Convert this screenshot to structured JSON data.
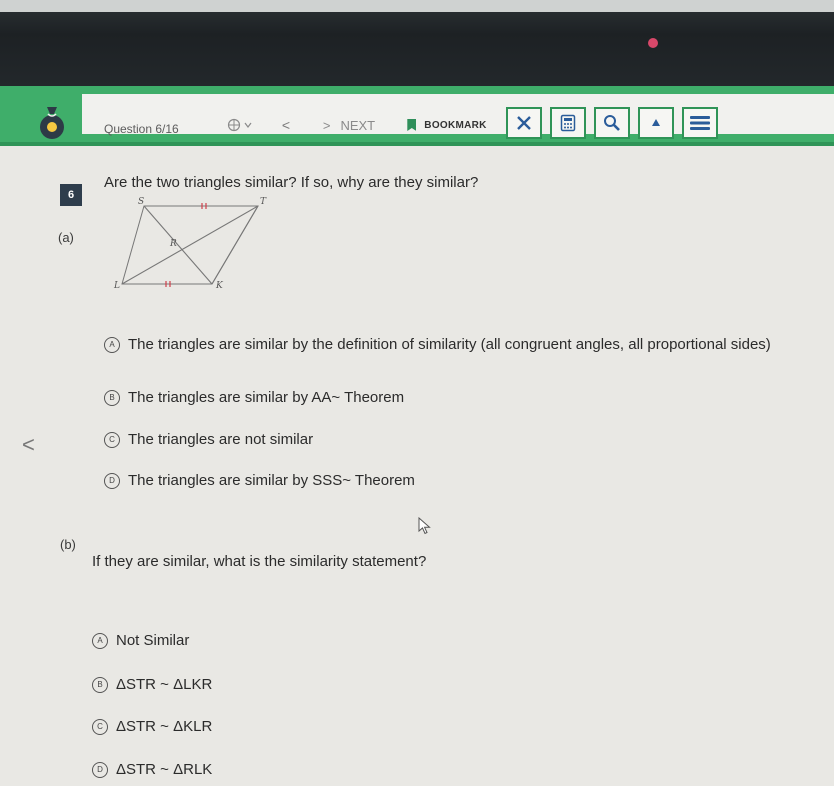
{
  "header": {
    "question_label": "Question 6/16",
    "next_label": "NEXT",
    "bookmark_label": "BOOKMARK",
    "prev_glyph": "<",
    "next_glyph": ">"
  },
  "question": {
    "number": "6",
    "prompt": "Are the two triangles similar? If so, why are they similar?",
    "part_a": {
      "label": "(a)",
      "figure_labels": {
        "S": "S",
        "T": "T",
        "R": "R",
        "L": "L",
        "K": "K"
      },
      "options": [
        {
          "letter": "A",
          "text": "The triangles are similar by the definition of similarity (all congruent angles, all proportional sides)"
        },
        {
          "letter": "B",
          "text": "The triangles are similar by AA~ Theorem"
        },
        {
          "letter": "C",
          "text": "The triangles are not similar"
        },
        {
          "letter": "D",
          "text": "The triangles are similar by SSS~ Theorem"
        }
      ]
    },
    "part_b": {
      "label": "(b)",
      "prompt": "If they are similar, what is the similarity statement?",
      "options": [
        {
          "letter": "A",
          "text": "Not Similar"
        },
        {
          "letter": "B",
          "text": "ΔSTR ~ ΔLKR"
        },
        {
          "letter": "C",
          "text": "ΔSTR ~ ΔKLR"
        },
        {
          "letter": "D",
          "text": "ΔSTR ~ ΔRLK"
        }
      ]
    }
  },
  "nav": {
    "side_arrow": "<"
  },
  "colors": {
    "header_green": "#3fae6a",
    "accent_dark": "#2f9457",
    "tick_red": "#d0404a"
  }
}
